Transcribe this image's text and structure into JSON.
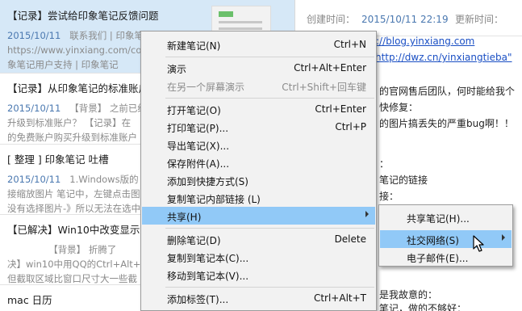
{
  "note_list": [
    {
      "title": "【记录】尝试给印象笔记反馈问题",
      "date": "2015/10/11",
      "lines": [
        "联系我们 | 印象笔记",
        "https://www.yinxiang.com/co",
        "象笔记用户支持 | 印象笔记"
      ],
      "selected": true,
      "has_thumbnail": true
    },
    {
      "title": "【记录】从印象笔记的标准账户",
      "date": "2015/10/11",
      "lines": [
        "【背景】 之前已经",
        "升级到标准账户？ 【记录】在",
        "的免费账户购买升级到标准账户"
      ],
      "selected": false
    },
    {
      "title": "[ 整理 ] 印象笔记 吐槽",
      "date": "2015/10/11",
      "lines": [
        "1.Windows版的",
        "接缩放图片 笔记中，左键点击图",
        "没有选择图片-》所以无法在选中"
      ],
      "selected": false
    },
    {
      "title": "【已解决】Win10中改变显示缩",
      "date": "",
      "lines": [
        "【背景】 折腾了",
        "决】win10中用QQ的Ctrl+Alt+",
        "但截取区域比窗口尺寸大一些截"
      ],
      "selected": false
    },
    {
      "title": "mac 日历",
      "date": "",
      "lines": [],
      "selected": false
    }
  ],
  "detail": {
    "created_label": "创建时间：",
    "created_value": "2015/10/11 22:19",
    "updated_label": "更新时间：",
    "lines": [
      {
        "text": "://blog.yinxiang.com",
        "link": true
      },
      {
        "text": "http://dwz.cn/yinxiangtieba\"",
        "link": true
      },
      {
        "text": "",
        "link": false
      },
      {
        "text": "的官网售后团队，何时能给我个",
        "link": false
      },
      {
        "text": "快修复：",
        "link": false
      },
      {
        "text": "的图片搞丢失的严重bug啊！！",
        "link": false
      },
      {
        "text": "",
        "link": false
      },
      {
        "text": "：",
        "link": false
      },
      {
        "text": "笔记的链接",
        "link": false
      },
      {
        "text": "接：",
        "link": false
      },
      {
        "text": "",
        "link": false
      },
      {
        "text": "",
        "link": false
      },
      {
        "text": "",
        "link": false
      },
      {
        "text": "",
        "link": false
      },
      {
        "text": "是我故意的：",
        "link": false
      },
      {
        "text": "笔记，做的不够好：",
        "link": false
      }
    ]
  },
  "context_menu": {
    "items": [
      {
        "label": "新建笔记(N)",
        "shortcut": "Ctrl+N"
      },
      {
        "separator": true
      },
      {
        "label": "演示",
        "shortcut": "Ctrl+Alt+Enter"
      },
      {
        "label": "在另一个屏幕演示",
        "shortcut": "Ctrl+Shift+回车键",
        "disabled": true
      },
      {
        "separator": true
      },
      {
        "label": "打开笔记(O)",
        "shortcut": "Ctrl+Enter"
      },
      {
        "label": "打印笔记(P)...",
        "shortcut": "Ctrl+P"
      },
      {
        "label": "导出笔记(X)..."
      },
      {
        "label": "保存附件(A)..."
      },
      {
        "label": "添加到快捷方式(S)"
      },
      {
        "label": "复制笔记内部链接 (L)"
      },
      {
        "label": "共享(H)",
        "submenu": true,
        "highlight": true
      },
      {
        "separator": true
      },
      {
        "label": "删除笔记(D)",
        "shortcut": "Delete"
      },
      {
        "label": "复制到笔记本(C)..."
      },
      {
        "label": "移动到笔记本(V)..."
      },
      {
        "separator": true
      },
      {
        "label": "添加标签(T)...",
        "shortcut": "Ctrl+Alt+T"
      }
    ]
  },
  "share_submenu": {
    "items": [
      {
        "label": "共享笔记(H)..."
      },
      {
        "label": "社交网络(S)",
        "submenu": true,
        "highlight": true
      },
      {
        "label": "电子邮件(E)..."
      }
    ]
  },
  "icons": {
    "cursor": "mouse-pointer-icon",
    "submenu_arrow": "chevron-right-icon"
  },
  "colors": {
    "highlight": "#91c9f7",
    "selected_note": "#d6e8f7",
    "link": "#1a4fc4",
    "date": "#4a78b0"
  }
}
